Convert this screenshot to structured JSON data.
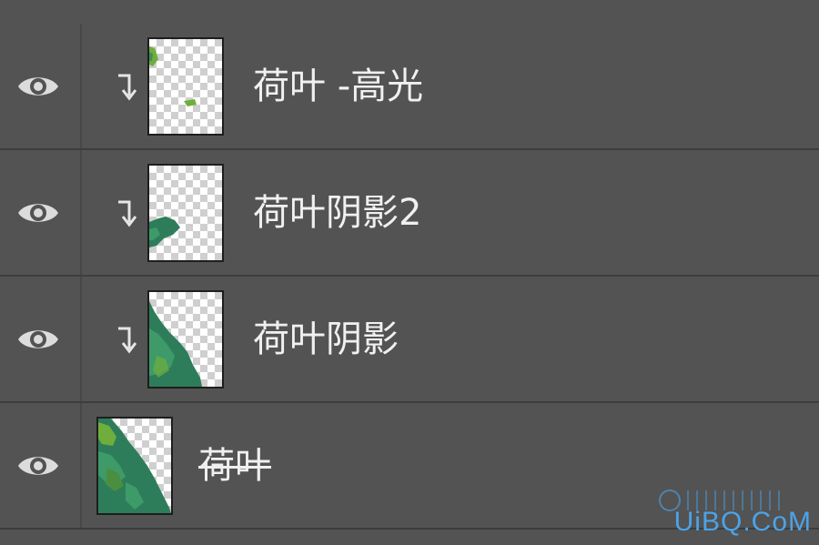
{
  "layers_panel": {
    "layers": [
      {
        "name": "荷叶 -高光",
        "visible": true,
        "clipped": true,
        "thumbnail": "leaf-highlight"
      },
      {
        "name": "荷叶阴影2",
        "visible": true,
        "clipped": true,
        "thumbnail": "leaf-shadow-2"
      },
      {
        "name": "荷叶阴影",
        "visible": true,
        "clipped": true,
        "thumbnail": "leaf-shadow"
      },
      {
        "name": "荷叶",
        "visible": true,
        "clipped": false,
        "thumbnail": "leaf-base"
      }
    ],
    "icons": {
      "visibility": "eye-icon",
      "clipping": "clipping-mask-arrow-icon"
    }
  },
  "watermark": {
    "text": "UiBQ.CoM"
  },
  "colors": {
    "panel_bg": "#535353",
    "divider": "#3d3d3d",
    "text": "#f0f0f0",
    "leaf_dark": "#2e7d5a",
    "leaf_light": "#6fae3c",
    "watermark": "#4ca3e8"
  }
}
